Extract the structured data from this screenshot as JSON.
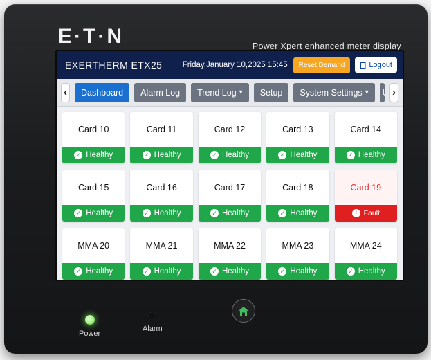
{
  "device": {
    "brand": "E·T·N",
    "subtitle": "Power Xpert enhanced meter display",
    "power_label": "Power",
    "alarm_label": "Alarm"
  },
  "topbar": {
    "model": "EXERTHERM  ETX25",
    "datetime": "Friday,January 10,2025 15:45",
    "reset_label": "Reset Demand",
    "logout_label": "Logout"
  },
  "nav": {
    "back": "‹",
    "forward": "›",
    "tabs": [
      {
        "label": "Dashboard"
      },
      {
        "label": "Alarm Log"
      },
      {
        "label": "Trend Log"
      },
      {
        "label": "Setup"
      },
      {
        "label": "System Settings"
      },
      {
        "label": "U"
      }
    ]
  },
  "cards": [
    {
      "name": "Card 10",
      "status": "Healthy"
    },
    {
      "name": "Card 11",
      "status": "Healthy"
    },
    {
      "name": "Card 12",
      "status": "Healthy"
    },
    {
      "name": "Card 13",
      "status": "Healthy"
    },
    {
      "name": "Card 14",
      "status": "Healthy"
    },
    {
      "name": "Card 15",
      "status": "Healthy"
    },
    {
      "name": "Card 16",
      "status": "Healthy"
    },
    {
      "name": "Card 17",
      "status": "Healthy"
    },
    {
      "name": "Card 18",
      "status": "Healthy"
    },
    {
      "name": "Card 19",
      "status": "Fault"
    },
    {
      "name": "MMA 20",
      "status": "Healthy"
    },
    {
      "name": "MMA 21",
      "status": "Healthy"
    },
    {
      "name": "MMA 22",
      "status": "Healthy"
    },
    {
      "name": "MMA 23",
      "status": "Healthy"
    },
    {
      "name": "MMA 24",
      "status": "Healthy"
    }
  ],
  "colors": {
    "healthy": "#20a74a",
    "fault": "#e02020",
    "active_tab": "#1b6fcf",
    "topbar": "#10204d",
    "reset": "#f6a623"
  }
}
